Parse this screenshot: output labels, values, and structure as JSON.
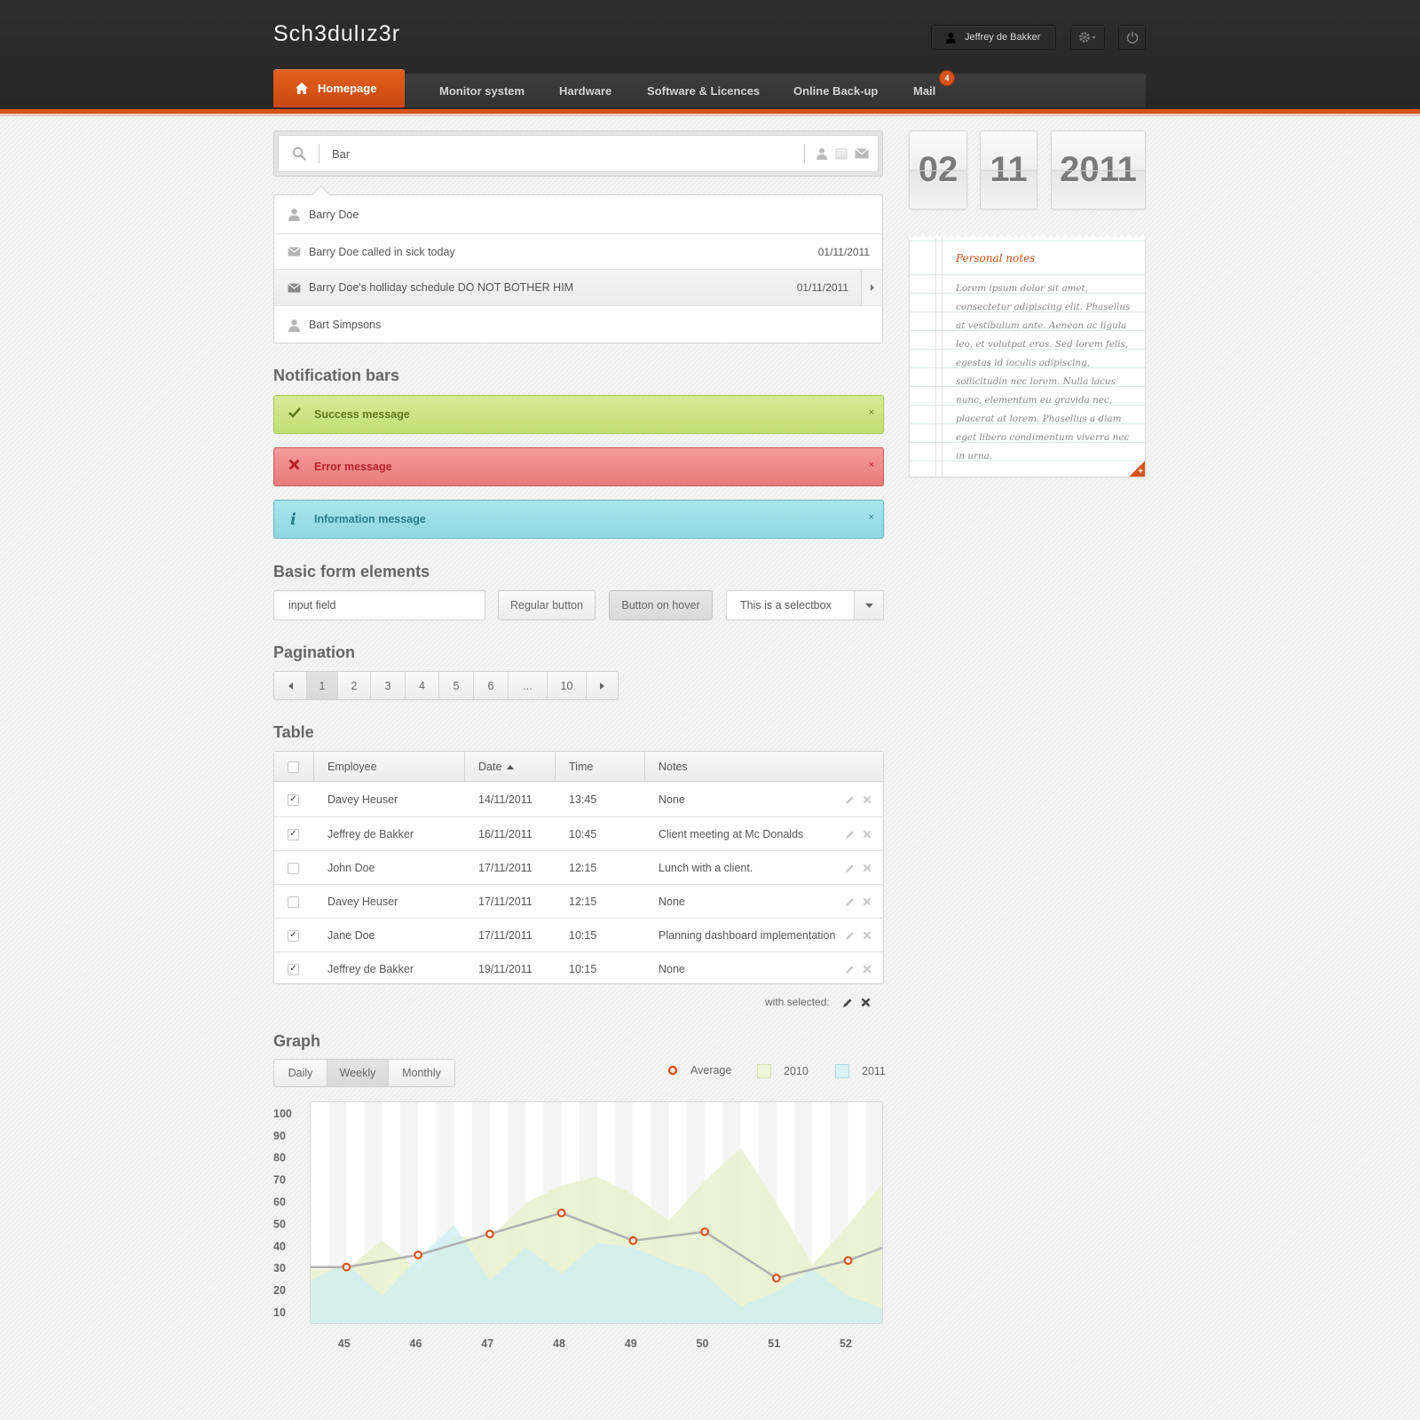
{
  "app": {
    "logo": "Sch3dulız3r",
    "user_name": "Jeffrey de Bakker"
  },
  "nav": {
    "items": [
      {
        "label": "Homepage",
        "icon": "home-icon",
        "active": true
      },
      {
        "label": "Monitor system"
      },
      {
        "label": "Hardware"
      },
      {
        "label": "Software & Licences"
      },
      {
        "label": "Online Back-up"
      },
      {
        "label": "Mail",
        "badge": "4"
      }
    ]
  },
  "search": {
    "value": "Bar",
    "results": [
      {
        "icon": "user-icon",
        "text": "Barry Doe",
        "date": ""
      },
      {
        "icon": "mail-icon",
        "text": "Barry Doe called in sick today",
        "date": "01/11/2011"
      },
      {
        "icon": "mail-icon",
        "text": "Barry Doe's holliday schedule DO NOT BOTHER HIM",
        "date": "01/11/2011",
        "highlighted": true
      },
      {
        "icon": "user-icon",
        "text": "Bart Simpsons",
        "date": ""
      }
    ]
  },
  "sections": {
    "notifications": "Notification bars",
    "form": "Basic form elements",
    "pagination": "Pagination",
    "table": "Table",
    "graph": "Graph"
  },
  "notifications": {
    "success": "Success message",
    "error": "Error message",
    "info": "Information message",
    "close": "×"
  },
  "form": {
    "input_value": "input field",
    "regular_button": "Regular button",
    "hover_button": "Button on hover",
    "select_value": "This is a selectbox"
  },
  "pagination": {
    "pages": [
      "1",
      "2",
      "3",
      "4",
      "5",
      "6",
      "...",
      "10"
    ],
    "current": "1"
  },
  "table": {
    "headers": {
      "employee": "Employee",
      "date": "Date",
      "time": "Time",
      "notes": "Notes"
    },
    "rows": [
      {
        "checked": true,
        "employee": "Davey Heuser",
        "date": "14/11/2011",
        "time": "13:45",
        "notes": "None"
      },
      {
        "checked": true,
        "employee": "Jeffrey de Bakker",
        "date": "16/11/2011",
        "time": "10:45",
        "notes": "Client meeting at Mc Donalds"
      },
      {
        "checked": false,
        "employee": "John Doe",
        "date": "17/11/2011",
        "time": "12:15",
        "notes": "Lunch with a client."
      },
      {
        "checked": false,
        "employee": "Davey Heuser",
        "date": "17/11/2011",
        "time": "12:15",
        "notes": "None"
      },
      {
        "checked": true,
        "employee": "Jane Doe",
        "date": "17/11/2011",
        "time": "10:15",
        "notes": "Planning dashboard implementation"
      },
      {
        "checked": true,
        "employee": "Jeffrey de Bakker",
        "date": "19/11/2011",
        "time": "10:15",
        "notes": "None"
      }
    ],
    "with_selected": "with selected:"
  },
  "graph": {
    "tabs": [
      "Daily",
      "Weekly",
      "Monthly"
    ],
    "active_tab": "Weekly",
    "legend": {
      "average": "Average",
      "y2010": "2010",
      "y2011": "2011"
    }
  },
  "chart_data": {
    "type": "area",
    "x": [
      "45",
      "46",
      "47",
      "48",
      "49",
      "50",
      "51",
      "52"
    ],
    "y_ticks": [
      10,
      20,
      30,
      40,
      50,
      60,
      70,
      80,
      90,
      100
    ],
    "ylim": [
      0,
      100
    ],
    "grid": "vertical stripes",
    "series": [
      {
        "name": "2010",
        "type": "area",
        "color": "#e9f2cf",
        "x": [
          44.5,
          45,
          45.5,
          46,
          46.5,
          47,
          47.5,
          48,
          48.5,
          49,
          49.5,
          50,
          50.5,
          51,
          51.5,
          52,
          52.5
        ],
        "values": [
          30,
          30,
          43,
          30,
          45,
          44,
          60,
          68,
          72,
          64,
          52,
          70,
          85,
          60,
          32,
          50,
          70
        ]
      },
      {
        "name": "2011",
        "type": "area",
        "color": "#cdeef2",
        "x": [
          44.5,
          45,
          45.5,
          46,
          46.5,
          47,
          47.5,
          48,
          48.5,
          49,
          49.5,
          50,
          50.5,
          51,
          51.5,
          52,
          52.5
        ],
        "values": [
          25,
          33,
          18,
          35,
          50,
          25,
          40,
          28,
          42,
          40,
          33,
          28,
          13,
          20,
          30,
          18,
          12
        ]
      },
      {
        "name": "Average",
        "type": "line",
        "color": "#b0b0b0",
        "marker_color": "#d8531b",
        "x": [
          44.5,
          45,
          46,
          47,
          48,
          49,
          50,
          51,
          52,
          52.5
        ],
        "values": [
          31,
          31,
          36.5,
          46,
          55.5,
          43,
          47,
          26,
          34,
          40
        ]
      }
    ]
  },
  "calendar": {
    "day": "02",
    "month": "11",
    "year": "2011"
  },
  "notes": {
    "title": "Personal notes",
    "body": "Lorem ipsum dolor sit amet, consectetur adipiscing elit. Phasellus at vestibulum ante. Aenean ac ligula leo, et volutpat eros. Sed lorem felis, egestas id iaculis adipiscing, sollicitudin nec lorem. Nulla lacus nunc, elementum eu gravida nec, placerat at lorem. Phasellus a diam eget libero condimentum viverra nec in urna.",
    "add_label": "+"
  },
  "colors": {
    "accent": "#d8531b",
    "header_bg": "#2b2b2b"
  }
}
